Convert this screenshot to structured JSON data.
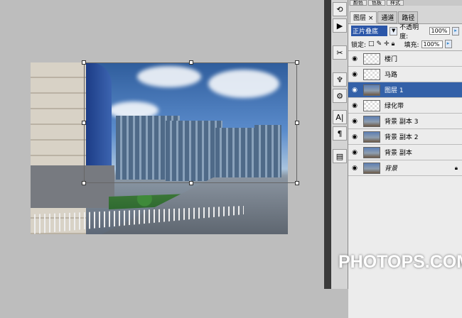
{
  "top_tabs": [
    "颜色",
    "色板",
    "样式"
  ],
  "layers_panel": {
    "tabs": [
      "图层 ×",
      "通道",
      "路径"
    ],
    "blend_mode": "正片叠底",
    "opacity_label": "不透明度:",
    "opacity": "100%",
    "lock_label": "锁定:",
    "fill_label": "填充:",
    "fill": "100%",
    "layers": [
      {
        "name": "楼门",
        "thumb": "checker"
      },
      {
        "name": "马路",
        "thumb": "checker"
      },
      {
        "name": "图层 1",
        "thumb": "photo",
        "selected": true
      },
      {
        "name": "绿化带",
        "thumb": "checker"
      },
      {
        "name": "背景 副本 3",
        "thumb": "photo"
      },
      {
        "name": "背景 副本 2",
        "thumb": "photo"
      },
      {
        "name": "背景 副本",
        "thumb": "photo"
      },
      {
        "name": "背景",
        "thumb": "photo",
        "locked": true
      }
    ]
  },
  "watermark": "PHOTOPS.COM"
}
